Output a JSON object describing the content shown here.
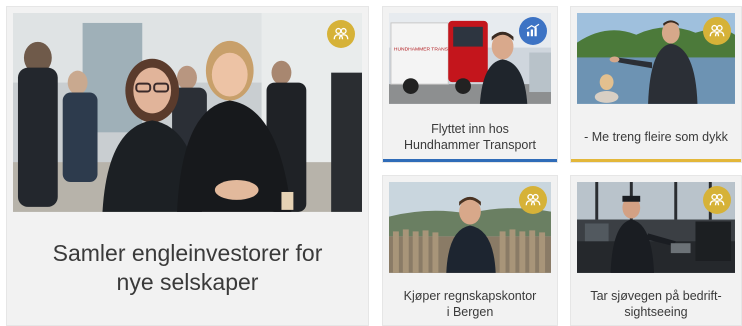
{
  "colors": {
    "badge_gold": "#d6b238",
    "badge_blue": "#3d73c4",
    "underline_blue": "#2f6cb8",
    "underline_gold": "#e3b73a"
  },
  "articles": [
    {
      "title": "Samler engleinvestorer for nye selskaper",
      "badge_icon": "people-icon"
    },
    {
      "title": "Flyttet inn hos Hundhammer Transport",
      "badge_icon": "chart-icon",
      "truck_text": "HUNDHAMMER TRANSPORT"
    },
    {
      "title": "- Me treng fleire som dykk",
      "badge_icon": "people-icon"
    },
    {
      "title": "Kjøper regnskapskontor i Bergen",
      "badge_icon": "people-icon"
    },
    {
      "title": "Tar sjøvegen på bedrift-sightseeing",
      "badge_icon": "people-icon"
    }
  ]
}
